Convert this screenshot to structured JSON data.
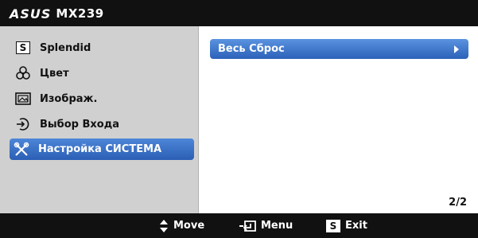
{
  "header": {
    "brand": "ASUS",
    "model": "MX239"
  },
  "sidebar": {
    "items": [
      {
        "label": "Splendid",
        "icon": "splendid-s-icon",
        "selected": false
      },
      {
        "label": "Цвет",
        "icon": "color-circles-icon",
        "selected": false
      },
      {
        "label": "Изображ.",
        "icon": "image-icon",
        "selected": false
      },
      {
        "label": "Выбор Входа",
        "icon": "input-select-icon",
        "selected": false
      },
      {
        "label": "Настройка СИСТЕМА",
        "icon": "tools-icon",
        "selected": true
      }
    ]
  },
  "main": {
    "reset_label": "Весь Сброс",
    "page_indicator": "2/2"
  },
  "footer": {
    "move_label": "Move",
    "menu_label": "Menu",
    "exit_label": "Exit",
    "exit_key": "S"
  },
  "colors": {
    "selected": "#3b74cc",
    "bar": "#111111",
    "sidebar": "#d0d0d0"
  }
}
